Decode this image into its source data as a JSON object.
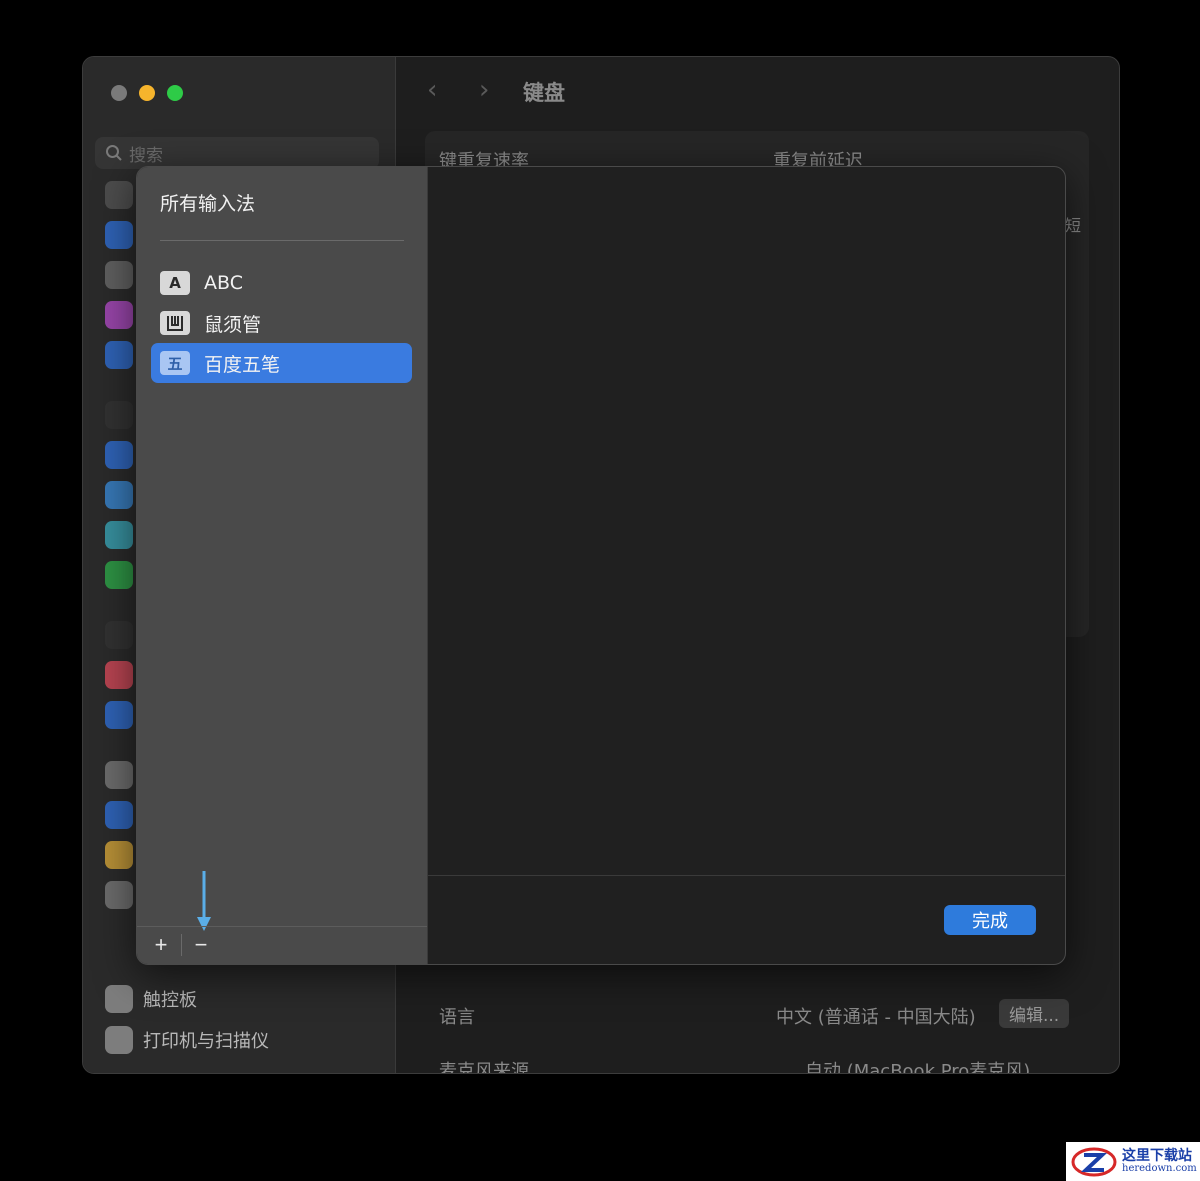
{
  "window": {
    "title": "键盘",
    "search_placeholder": "搜索"
  },
  "sidebar": {
    "items": [
      {
        "label": "触控板"
      },
      {
        "label": "打印机与扫描仪"
      }
    ],
    "icon_colors": [
      "#555555",
      "#2f6fd6",
      "#6b6b6b",
      "#b04bc6",
      "#2f6fd6",
      "#333333",
      "#2f6fd6",
      "#3a8ad6",
      "#3aa6b8",
      "#2eaa4a",
      "#333333",
      "#d84a5a",
      "#2f6fd6",
      "#7a7a7a",
      "#2f6fd6",
      "#d8a83a",
      "#7a7a7a"
    ]
  },
  "main_bg": {
    "key_repeat_rate": "键重复速率",
    "delay_until_repeat": "重复前延迟",
    "short_fragment": "短",
    "language_label": "语言",
    "language_value": "中文 (普通话 - 中国大陆)",
    "edit_button": "编辑...",
    "mic_label": "麦克风来源",
    "mic_value": "自动 (MacBook Pro麦克风)"
  },
  "sheet": {
    "heading": "所有输入法",
    "input_methods": [
      {
        "badge": "A",
        "label": "ABC",
        "selected": false
      },
      {
        "badge": "",
        "label": "鼠须管",
        "selected": false
      },
      {
        "badge": "五",
        "label": "百度五笔",
        "selected": true
      }
    ],
    "add_button": "+",
    "remove_button": "−",
    "done_button": "完成"
  },
  "watermark": {
    "cn": "这里下载站",
    "en": "heredown.com"
  },
  "colors": {
    "accent": "#3a7be0",
    "done": "#2e7bdc",
    "arrow": "#5aaee8"
  }
}
